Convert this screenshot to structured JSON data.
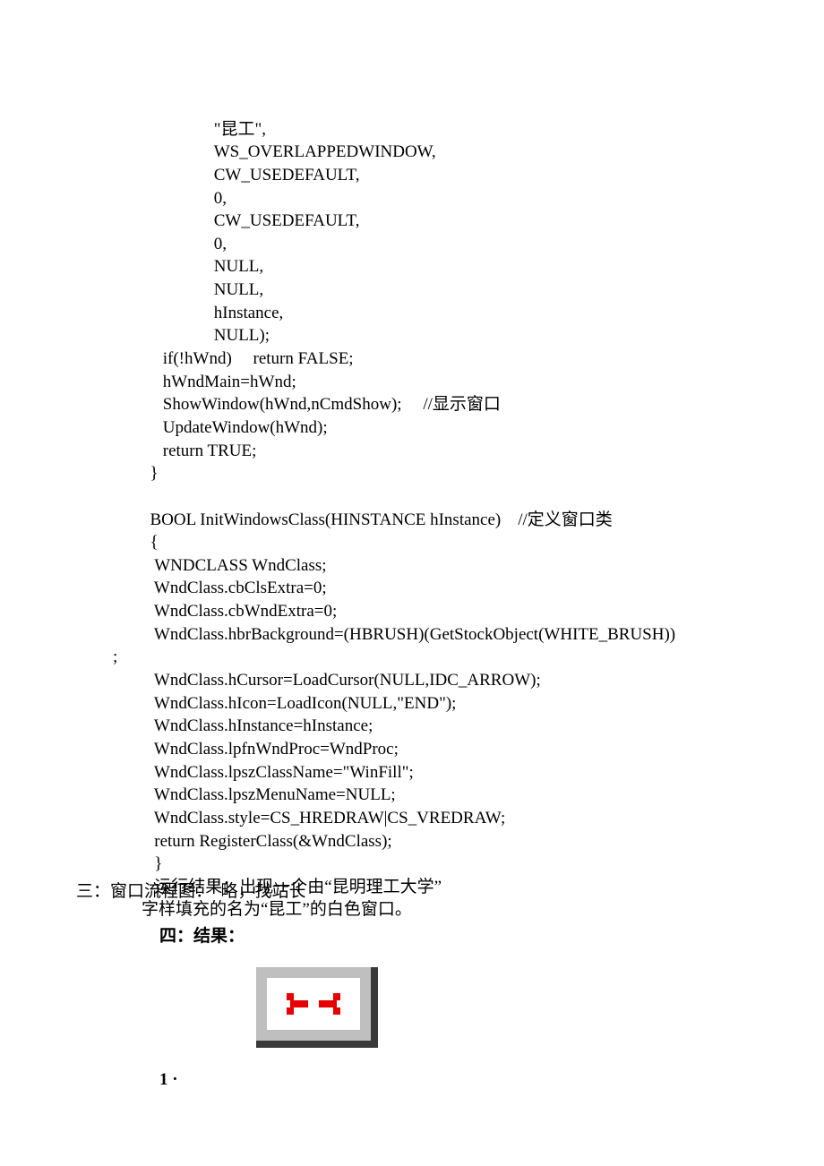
{
  "code": {
    "l1": "                 \"昆工\",",
    "l2": "                 WS_OVERLAPPEDWINDOW,",
    "l3": "                 CW_USEDEFAULT,",
    "l4": "                 0,",
    "l5": "                 CW_USEDEFAULT,",
    "l6": "                 0,",
    "l7": "                 NULL,",
    "l8": "                 NULL,",
    "l9": "                 hInstance,",
    "l10": "                 NULL);",
    "l11": "     if(!hWnd)     return FALSE;",
    "l12": "     hWndMain=hWnd;",
    "l13": "     ShowWindow(hWnd,nCmdShow);     //显示窗口",
    "l14": "     UpdateWindow(hWnd);",
    "l15": "     return TRUE;",
    "l16": "  }",
    "l17": "",
    "l18": "  BOOL InitWindowsClass(HINSTANCE hInstance)    //定义窗口类",
    "l19": "  {",
    "l20": "   WNDCLASS WndClass;",
    "l21": "   WndClass.cbClsExtra=0;",
    "l22": "   WndClass.cbWndExtra=0;",
    "l23": "   WndClass.hbrBackground=(HBRUSH)(GetStockObject(WHITE_BRUSH))",
    "l24": ";",
    "l25": "   WndClass.hCursor=LoadCursor(NULL,IDC_ARROW);",
    "l26": "   WndClass.hIcon=LoadIcon(NULL,\"END\");",
    "l27": "   WndClass.hInstance=hInstance;",
    "l28": "   WndClass.lpfnWndProc=WndProc;",
    "l29": "   WndClass.lpszClassName=\"WinFill\";",
    "l30": "   WndClass.lpszMenuName=NULL;",
    "l31": "   WndClass.style=CS_HREDRAW|CS_VREDRAW;",
    "l32": "   return RegisterClass(&WndClass);",
    "l33": "   }",
    "l34": "   运行结果：出现一个由“昆明理工大学”",
    "l35": "字样填充的名为“昆工”的白色窗口。"
  },
  "section3": "三：窗口流程图：  略，找站长",
  "section4": "四：结果：",
  "pagenum": "1 ·"
}
